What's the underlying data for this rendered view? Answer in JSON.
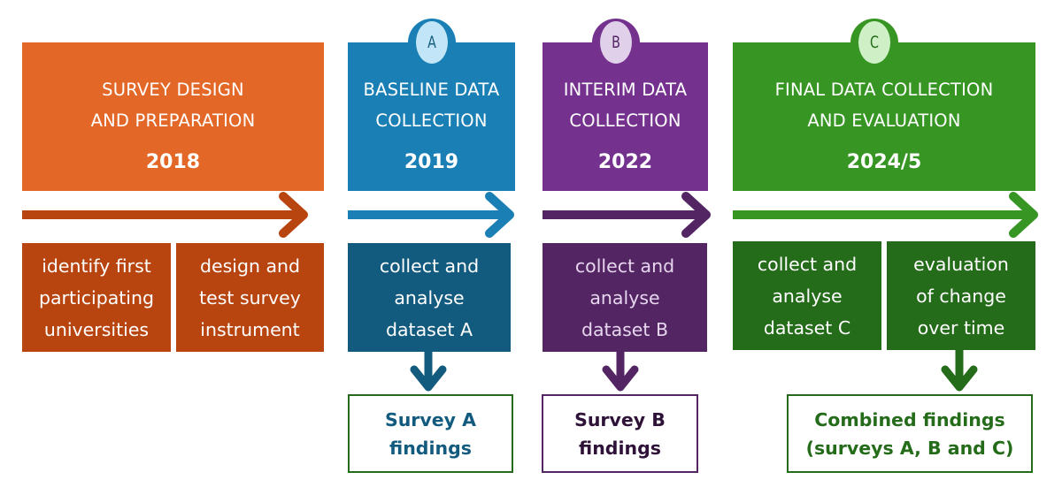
{
  "diagram_title": "",
  "colors": {
    "orange": "#E36727",
    "orange_dark": "#B84510",
    "blue": "#1A7FB5",
    "blue_dark": "#125B7E",
    "blue_light": "#C2E6F7",
    "purple": "#74318E",
    "purple_dark": "#532563",
    "purple_light": "#E0D0EA",
    "green": "#379623",
    "green_dark": "#246B1A",
    "green_light": "#CFF0C6"
  },
  "phases": [
    {
      "id": "design",
      "badge": null,
      "title": "SURVEY DESIGN\nAND PREPARATION",
      "year": "2018",
      "tasks": [
        "identify first\nparticipating\nuniversities",
        "design and\ntest survey\ninstrument"
      ],
      "findings": null
    },
    {
      "id": "baseline",
      "badge": "A",
      "title": "BASELINE DATA\nCOLLECTION",
      "year": "2019",
      "tasks": [
        "collect and\nanalyse\ndataset A"
      ],
      "findings": "Survey A\nfindings"
    },
    {
      "id": "interim",
      "badge": "B",
      "title": "INTERIM DATA\nCOLLECTION",
      "year": "2022",
      "tasks": [
        "collect and\nanalyse\ndataset B"
      ],
      "findings": "Survey B\nfindings"
    },
    {
      "id": "final",
      "badge": "C",
      "title": "FINAL DATA COLLECTION\nAND EVALUATION",
      "year": "2024/5",
      "tasks": [
        "collect and\nanalyse\ndataset C",
        "evaluation\nof change\nover time"
      ],
      "findings": "Combined findings\n(surveys A, B and C)"
    }
  ]
}
